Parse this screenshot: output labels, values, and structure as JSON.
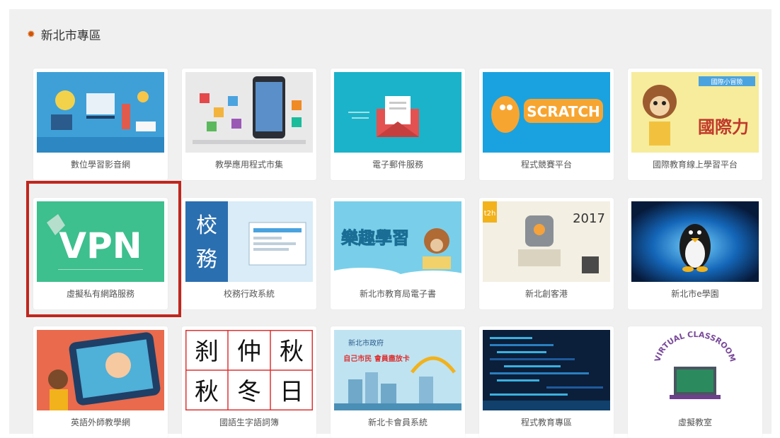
{
  "section": {
    "title": "新北市專區",
    "icon": "gear-icon"
  },
  "tiles": [
    {
      "label": "數位學習影音網"
    },
    {
      "label": "教學應用程式市集"
    },
    {
      "label": "電子郵件服務"
    },
    {
      "label": "程式競賽平台",
      "art_text": "SCRATCH"
    },
    {
      "label": "國際教育線上學習平台",
      "art_text": "國際力",
      "art_badge": "國際小冒險"
    },
    {
      "label": "虛擬私有網路服務",
      "art_text": "VPN"
    },
    {
      "label": "校務行政系統",
      "art_text": "校務"
    },
    {
      "label": "新北市教育局電子書",
      "art_text": "樂趣學習"
    },
    {
      "label": "新北創客港",
      "art_text": "2017",
      "art_badge": "t2h"
    },
    {
      "label": "新北市e學園"
    },
    {
      "label": "英語外師教學網"
    },
    {
      "label": "國語生字語詞簿",
      "art_chars": [
        "刹",
        "仲",
        "秋",
        "秋",
        "冬",
        "日"
      ]
    },
    {
      "label": "新北卡會員系統",
      "art_text": "新北市政府",
      "art_badge": "自己市民 會員盡放卡"
    },
    {
      "label": "程式教育專區"
    },
    {
      "label": "虛擬教室",
      "art_text": "VIRTUAL CLASSROOM"
    }
  ],
  "highlight_color": "#c0261d"
}
